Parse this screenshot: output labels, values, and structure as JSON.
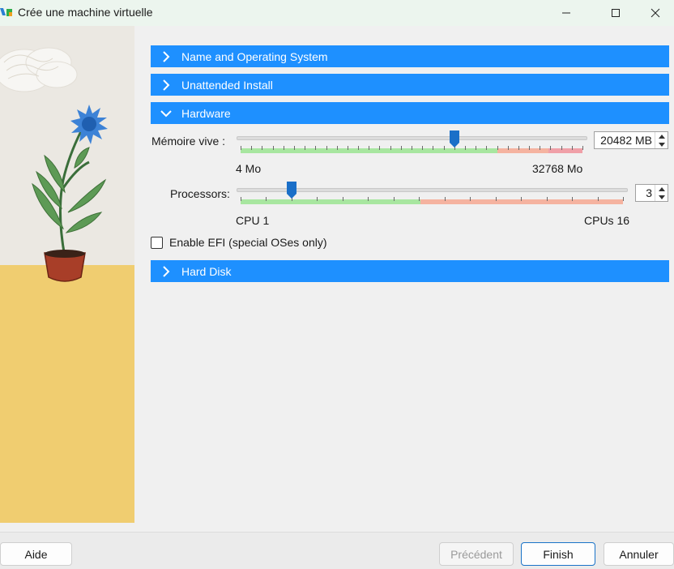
{
  "window": {
    "title": "Crée une machine virtuelle"
  },
  "sections": [
    {
      "label": "Name and Operating System",
      "expanded": false
    },
    {
      "label": "Unattended Install",
      "expanded": false
    },
    {
      "label": "Hardware",
      "expanded": true
    },
    {
      "label": "Hard Disk",
      "expanded": false
    }
  ],
  "memory": {
    "label": "Mémoire vive :",
    "value": "20482 MB",
    "value_mb": 20482,
    "min_label": "4 Mo",
    "max_label": "32768 Mo",
    "min": 4,
    "max": 32768
  },
  "processors": {
    "label": "Processors:",
    "value": "3",
    "min_label": "CPU 1",
    "max_label": "CPUs 16",
    "min": 1,
    "max": 16
  },
  "efi": {
    "label": "Enable EFI (special OSes only)",
    "checked": false
  },
  "buttons": {
    "help": "Aide",
    "back": "Précédent",
    "finish": "Finish",
    "cancel": "Annuler"
  },
  "colors": {
    "section_header": "#1e90ff",
    "scale_ok": "#a8e6a0",
    "scale_warn": "#f5b3a0",
    "scale_bad": "#f0a0a8",
    "thumb": "#1a6fc8"
  },
  "icons": {
    "app": "virtualbox-icon",
    "section_collapsed": "chevron-right-icon",
    "section_expanded": "chevron-down-icon"
  }
}
